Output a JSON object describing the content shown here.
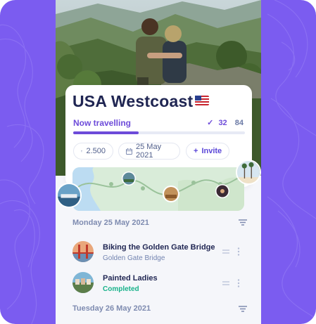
{
  "colors": {
    "accent": "#6d4bd9",
    "background": "#7b5cf0",
    "completed": "#18b28a"
  },
  "trip": {
    "title": "USA Westcoast",
    "flag_icon": "us-flag-icon",
    "status": "Now travelling",
    "done_count": "32",
    "total_count": "84",
    "progress": 0.38
  },
  "chips": {
    "budget": "2.500",
    "date": "25 May 2021",
    "invite": "Invite"
  },
  "days": [
    {
      "label": "Monday 25 May 2021"
    },
    {
      "label": "Tuesday 26 May 2021"
    }
  ],
  "items": [
    {
      "title": "Biking the Golden Gate Bridge",
      "subtitle": "Golden Gate Bridge"
    },
    {
      "title": "Painted Ladies",
      "subtitle": "Completed"
    }
  ]
}
